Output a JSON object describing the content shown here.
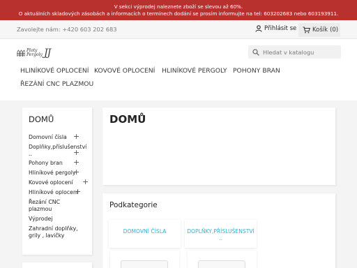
{
  "promo": {
    "line1": "V sekci výprodej naleznete zboží se slevou až 60%.",
    "line2": "O aktuálních skladových zásobách a informacích o termínech dodání se  prosím informujte na tel: 603202683 nebo 603193911."
  },
  "topbar": {
    "contact": "Zavolejte nám: +420 603 202 683",
    "signin_label": "Přihlásit se",
    "cart_label": "Košík",
    "cart_count": "(0)"
  },
  "header": {
    "logo_line1": "Ploty",
    "logo_line2": "Pergoly",
    "logo_mark": "JJ",
    "search_placeholder": "Hledat v katalogu"
  },
  "nav": [
    {
      "label": "HLINÍKOVÉ OPLOCENÍ"
    },
    {
      "label": "KOVOVÉ OPLOCENÍ"
    },
    {
      "label": "HLINÍKOVÉ PERGOLY"
    },
    {
      "label": "POHONY BRAN"
    },
    {
      "label": "ŘEZÁNÍ CNC PLAZMOU"
    }
  ],
  "sidebar": {
    "title": "DOMŮ",
    "items": [
      {
        "label": "Domovní čísla",
        "expandable": true
      },
      {
        "label": "Doplňky,příslušenství ..",
        "expandable": true
      },
      {
        "label": "Pohony bran",
        "expandable": true
      },
      {
        "label": "Hliníkové pergoly",
        "expandable": true
      },
      {
        "label": "Kovové oplocení",
        "expandable": true
      },
      {
        "label": "Hliníkové oplocení",
        "expandable": true
      },
      {
        "label": "Řezání CNC plazmou",
        "expandable": false
      },
      {
        "label": "Výprodej",
        "expandable": false
      },
      {
        "label": "Zahradní doplňky, grily , lavičky",
        "expandable": false
      }
    ]
  },
  "main": {
    "title": "DOMŮ",
    "subcategories_title": "Podkategorie",
    "subcategories": [
      {
        "label": "DOMOVNÍ ČÍSLA"
      },
      {
        "label": "DOPLŇKY,PŘÍSLUŠENSTVÍ .."
      }
    ]
  },
  "icons": {
    "user": "user-icon",
    "cart": "cart-icon",
    "search": "search-icon",
    "plus": "plus-icon"
  },
  "colors": {
    "promo_bg": "#b8312f",
    "link": "#2fb5d2"
  }
}
